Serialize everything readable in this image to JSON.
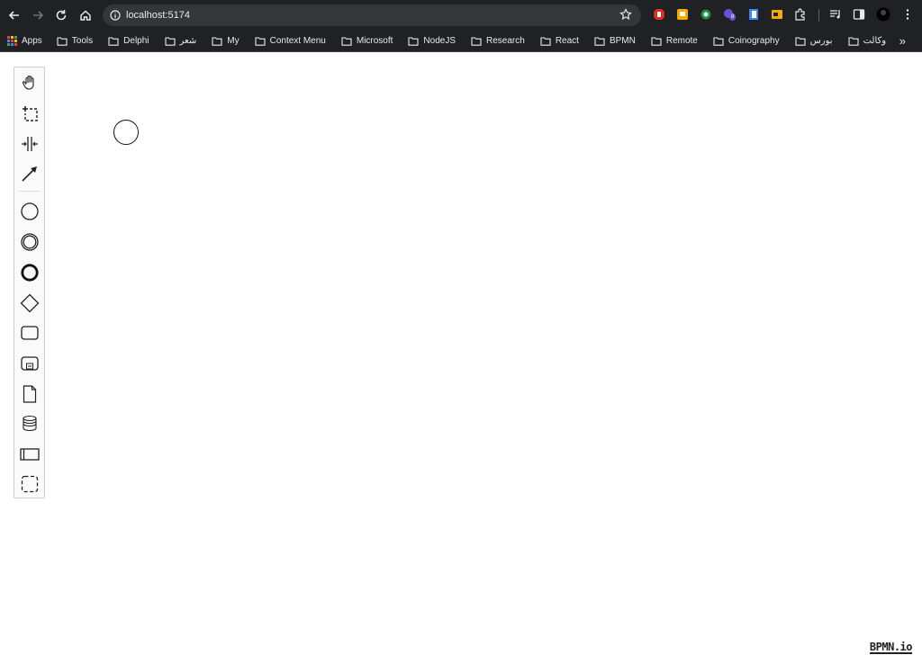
{
  "browser": {
    "url": "localhost:5174",
    "bookmarks": [
      {
        "label": "Apps",
        "icon": "apps-grid-icon"
      },
      {
        "label": "Tools",
        "icon": "folder-icon"
      },
      {
        "label": "Delphi",
        "icon": "folder-icon"
      },
      {
        "label": "شعر",
        "icon": "folder-icon"
      },
      {
        "label": "My",
        "icon": "folder-icon"
      },
      {
        "label": "Context Menu",
        "icon": "folder-icon"
      },
      {
        "label": "Microsoft",
        "icon": "folder-icon"
      },
      {
        "label": "NodeJS",
        "icon": "folder-icon"
      },
      {
        "label": "Research",
        "icon": "folder-icon"
      },
      {
        "label": "React",
        "icon": "folder-icon"
      },
      {
        "label": "BPMN",
        "icon": "folder-icon"
      },
      {
        "label": "Remote",
        "icon": "folder-icon"
      },
      {
        "label": "Coinography",
        "icon": "folder-icon"
      },
      {
        "label": "بورس",
        "icon": "folder-icon"
      },
      {
        "label": "وكالت",
        "icon": "folder-icon"
      }
    ],
    "more_bookmarks": "»",
    "extension_badge": "8"
  },
  "palette": {
    "tools": [
      {
        "name": "hand-tool",
        "icon": "hand-icon"
      },
      {
        "name": "lasso-tool",
        "icon": "lasso-icon"
      },
      {
        "name": "space-tool",
        "icon": "space-icon"
      },
      {
        "name": "global-connect-tool",
        "icon": "connect-arrow-icon"
      },
      {
        "name": "start-event",
        "icon": "start-event-icon"
      },
      {
        "name": "intermediate-event",
        "icon": "intermediate-event-icon"
      },
      {
        "name": "end-event",
        "icon": "end-event-icon"
      },
      {
        "name": "gateway",
        "icon": "gateway-icon"
      },
      {
        "name": "task",
        "icon": "task-icon"
      },
      {
        "name": "subprocess",
        "icon": "subprocess-icon"
      },
      {
        "name": "data-object",
        "icon": "data-object-icon"
      },
      {
        "name": "data-store",
        "icon": "data-store-icon"
      },
      {
        "name": "participant",
        "icon": "pool-icon"
      },
      {
        "name": "group",
        "icon": "group-icon"
      }
    ]
  },
  "logo": {
    "text": "BPMN.io"
  }
}
